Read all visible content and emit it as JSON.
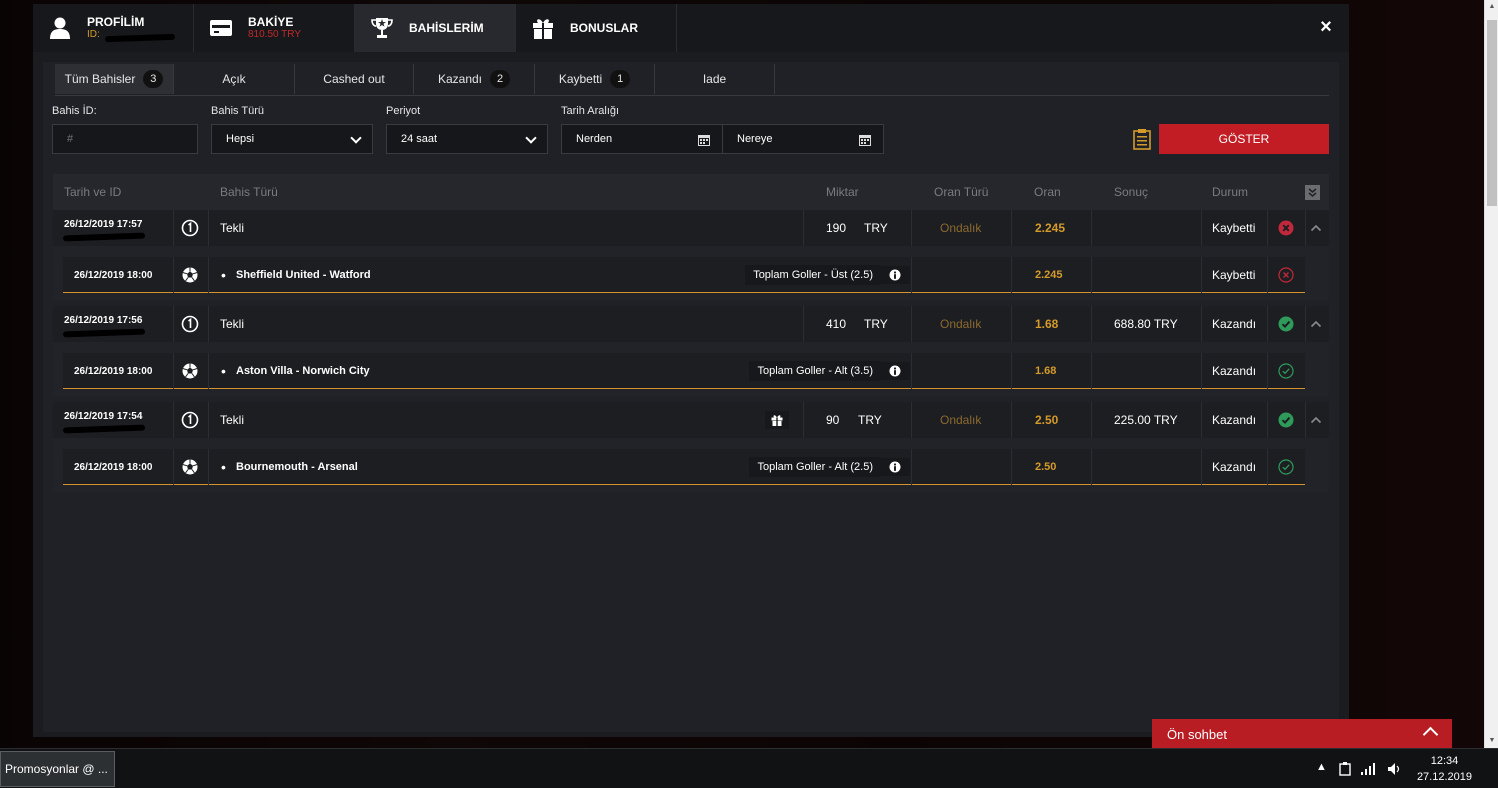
{
  "modal": {
    "tabs": [
      {
        "title": "PROFİLİM",
        "sub": "ID:",
        "icon": "user-icon"
      },
      {
        "title": "BAKİYE",
        "sub": "810.50 TRY",
        "icon": "wallet-icon"
      },
      {
        "title": "BAHİSLERİM",
        "sub": "",
        "icon": "trophy-icon"
      },
      {
        "title": "BONUSLAR",
        "sub": "",
        "icon": "gift-icon"
      }
    ],
    "close_label": "×"
  },
  "filters": {
    "tabs": [
      {
        "label": "Tüm Bahisler",
        "count": "3"
      },
      {
        "label": "Açık",
        "count": ""
      },
      {
        "label": "Cashed out",
        "count": ""
      },
      {
        "label": "Kazandı",
        "count": "2"
      },
      {
        "label": "Kaybetti",
        "count": "1"
      },
      {
        "label": "Iade",
        "count": ""
      }
    ],
    "bet_id_label": "Bahis İD:",
    "bet_id_placeholder": "#",
    "bet_type_label": "Bahis Türü",
    "bet_type_value": "Hepsi",
    "period_label": "Periyot",
    "period_value": "24 saat",
    "date_range_label": "Tarih Aralığı",
    "from_value": "Nerden",
    "to_value": "Nereye",
    "show_button": "GÖSTER"
  },
  "table": {
    "headers": {
      "date_id": "Tarih ve ID",
      "bet_type": "Bahis Türü",
      "amount": "Miktar",
      "odds_type": "Oran Türü",
      "odds": "Oran",
      "result": "Sonuç",
      "status": "Durum"
    },
    "bets": [
      {
        "date": "26/12/2019 17:57",
        "type": "Tekli",
        "amount": "190",
        "currency": "TRY",
        "odds_type": "Ondalık",
        "odds": "2.245",
        "result": "",
        "status": "Kaybetti",
        "status_kind": "lost",
        "gift": false,
        "selection": {
          "date": "26/12/2019 18:00",
          "match": "Sheffield United - Watford",
          "market": "Toplam Goller - Üst (2.5)",
          "odds": "2.245",
          "status": "Kaybetti"
        }
      },
      {
        "date": "26/12/2019 17:56",
        "type": "Tekli",
        "amount": "410",
        "currency": "TRY",
        "odds_type": "Ondalık",
        "odds": "1.68",
        "result": "688.80 TRY",
        "status": "Kazandı",
        "status_kind": "won",
        "gift": false,
        "selection": {
          "date": "26/12/2019 18:00",
          "match": "Aston Villa - Norwich City",
          "market": "Toplam Goller - Alt (3.5)",
          "odds": "1.68",
          "status": "Kazandı"
        }
      },
      {
        "date": "26/12/2019 17:54",
        "type": "Tekli",
        "amount": "90",
        "currency": "TRY",
        "odds_type": "Ondalık",
        "odds": "2.50",
        "result": "225.00 TRY",
        "status": "Kazandı",
        "status_kind": "won",
        "gift": true,
        "selection": {
          "date": "26/12/2019 18:00",
          "match": "Bournemouth - Arsenal",
          "market": "Toplam Goller - Alt (2.5)",
          "odds": "2.50",
          "status": "Kazandı"
        }
      }
    ]
  },
  "chat": {
    "label": "Ön sohbet"
  },
  "taskbar": {
    "item": "Promosyonlar @ ...",
    "time": "12:34",
    "date": "27.12.2019"
  },
  "colors": {
    "accent_red": "#c21d24",
    "odds_orange": "#d49a2a",
    "won_green": "#2e9b5a",
    "lost_red": "#c2283b"
  }
}
